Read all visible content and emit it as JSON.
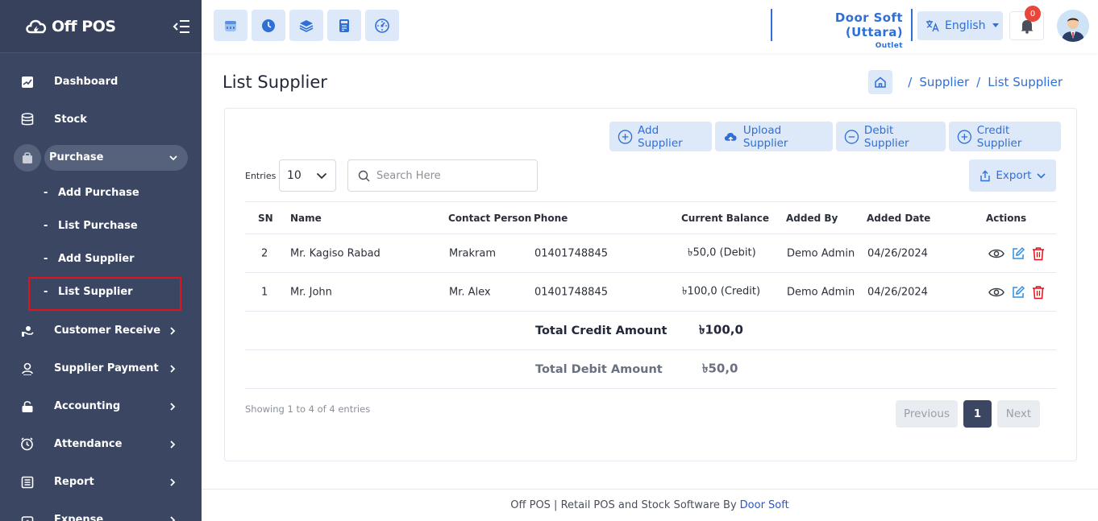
{
  "brand": {
    "name": "Off POS"
  },
  "sidebar": {
    "items": [
      {
        "label": "Dashboard",
        "icon": "dashboard-icon"
      },
      {
        "label": "Stock",
        "icon": "database-icon"
      },
      {
        "label": "Purchase",
        "icon": "bag-icon",
        "expanded": true
      },
      {
        "label": "Customer Receive",
        "icon": "hand-coin-icon"
      },
      {
        "label": "Supplier Payment",
        "icon": "payment-icon"
      },
      {
        "label": "Accounting",
        "icon": "lock-icon"
      },
      {
        "label": "Attendance",
        "icon": "clock-icon"
      },
      {
        "label": "Report",
        "icon": "report-icon"
      },
      {
        "label": "Expense",
        "icon": "wallet-icon"
      }
    ],
    "purchase_sub": [
      {
        "label": "Add Purchase"
      },
      {
        "label": "List Purchase"
      },
      {
        "label": "Add Supplier"
      },
      {
        "label": "List Supplier",
        "current": true
      }
    ]
  },
  "topbar": {
    "outlet_name": "Door Soft (Uttara)",
    "outlet_type": "Outlet",
    "language": "English",
    "notification_count": "0"
  },
  "page": {
    "title": "List Supplier",
    "breadcrumb": [
      "Supplier",
      "List Supplier"
    ]
  },
  "actions": {
    "add": "Add Supplier",
    "upload": "Upload Supplier",
    "debit": "Debit Supplier",
    "credit": "Credit Supplier",
    "export": "Export"
  },
  "filters": {
    "entries_label": "Entries",
    "entries_value": "10",
    "search_placeholder": "Search Here"
  },
  "table": {
    "headers": [
      "SN",
      "Name",
      "Contact Person",
      "Phone",
      "Current Balance",
      "Added By",
      "Added Date",
      "Actions"
    ],
    "rows": [
      {
        "sn": "2",
        "name": "Mr. Kagiso Rabad",
        "contact": "Mrakram",
        "phone": "01401748845",
        "balance": "৳50,0 (Debit)",
        "added_by": "Demo Admin",
        "added_date": "04/26/2024"
      },
      {
        "sn": "1",
        "name": "Mr. John",
        "contact": "Mr. Alex",
        "phone": "01401748845",
        "balance": "৳100,0 (Credit)",
        "added_by": "Demo Admin",
        "added_date": "04/26/2024"
      }
    ],
    "totals": [
      {
        "label": "Total Credit Amount",
        "value": "৳100,0"
      },
      {
        "label": "Total Debit Amount",
        "value": "৳50,0"
      }
    ]
  },
  "pagination": {
    "showing": "Showing 1 to 4 of 4 entries",
    "prev": "Previous",
    "current": "1",
    "next": "Next"
  },
  "footer": {
    "text": "Off POS | Retail POS and Stock Software By",
    "link": "Door Soft"
  },
  "colors": {
    "sidebar": "#3b4663",
    "accent": "#2f6fd6",
    "danger": "#e0121b"
  }
}
